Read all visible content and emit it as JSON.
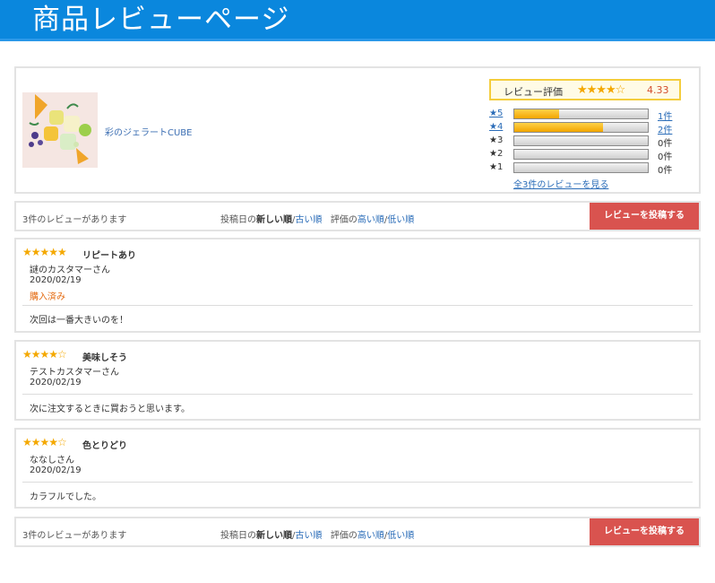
{
  "header": {
    "title": "商品レビューページ"
  },
  "product": {
    "name": "彩のジェラートCUBE",
    "image_icon": "gelato-product-image"
  },
  "rating": {
    "label": "レビュー評価",
    "stars": "★★★★☆",
    "score": "4.33",
    "distribution": [
      {
        "star_label": "★5",
        "count": "1件",
        "fraction": 0.333,
        "linked": true
      },
      {
        "star_label": "★4",
        "count": "2件",
        "fraction": 0.667,
        "linked": true
      },
      {
        "star_label": "★3",
        "count": "0件",
        "fraction": 0,
        "linked": false
      },
      {
        "star_label": "★2",
        "count": "0件",
        "fraction": 0,
        "linked": false
      },
      {
        "star_label": "★1",
        "count": "0件",
        "fraction": 0,
        "linked": false
      }
    ],
    "all_reviews_link": "全3件のレビューを見る"
  },
  "toolbar": {
    "count_text": "3件のレビューがあります",
    "date_prefix": "投稿日の",
    "sort_new": "新しい順",
    "sort_sep": "/",
    "sort_old": "古い順",
    "rating_prefix": "評価の",
    "sort_high": "高い順",
    "sort_low": "低い順",
    "post_button": "レビューを投稿する"
  },
  "reviews": [
    {
      "stars": "★★★★★",
      "title": "リピートあり",
      "author": "謎のカスタマーさん",
      "date": "2020/02/19",
      "badge": "購入済み",
      "body": "次回は一番大きいのを！"
    },
    {
      "stars": "★★★★☆",
      "title": "美味しそう",
      "author": "テストカスタマーさん",
      "date": "2020/02/19",
      "badge": "",
      "body": "次に注文するときに買おうと思います。"
    },
    {
      "stars": "★★★★☆",
      "title": "色とりどり",
      "author": "ななしさん",
      "date": "2020/02/19",
      "badge": "",
      "body": "カラフルでした。"
    }
  ],
  "colors": {
    "header": "#0a87dd",
    "button": "#d9534f",
    "star": "#f4a800",
    "link": "#2a6cb8",
    "badge": "#e46b12"
  }
}
